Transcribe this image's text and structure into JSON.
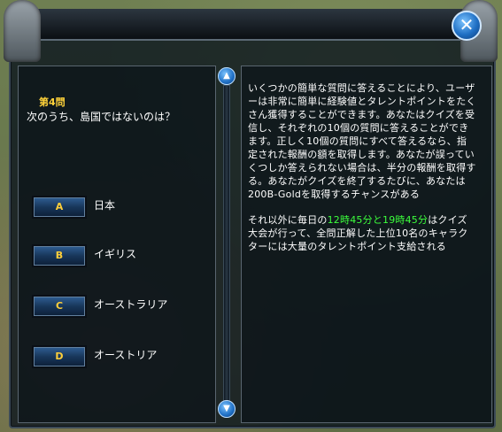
{
  "window": {
    "close_icon": "close-x-icon"
  },
  "question": {
    "number": "第4問",
    "text": "次のうち、島国ではないのは？"
  },
  "answers": [
    {
      "key": "A",
      "label": "日本"
    },
    {
      "key": "B",
      "label": "イギリス"
    },
    {
      "key": "C",
      "label": "オーストラリア"
    },
    {
      "key": "D",
      "label": "オーストリア"
    }
  ],
  "description": {
    "para1": "いくつかの簡単な質問に答えることにより、ユーザーは非常に簡単に経験値とタレントポイントをたくさん獲得することができます。あなたはクイズを受信し、それぞれの10個の質問に答えることができます。正しく10個の質問にすべて答えるなら、指定された報酬の額を取得します。あなたが誤っていくつしか答えられない場合は、半分の報酬を取得する。あなたがクイズを終了するたびに、あなたは200B-Goldを取得するチャンスがある",
    "para2_prefix": "それ以外に毎日の",
    "para2_time1": "12時45分",
    "para2_and": "と",
    "para2_time2": "19時45分",
    "para2_suffix": "はクイズ大会が行って、全問正解した上位10名のキャラクターには大量のタレントポイント支給される"
  },
  "colors": {
    "accent_gold": "#ffd23a",
    "highlight_green": "#3cff3c",
    "button_blue": "#1f6fc4"
  }
}
